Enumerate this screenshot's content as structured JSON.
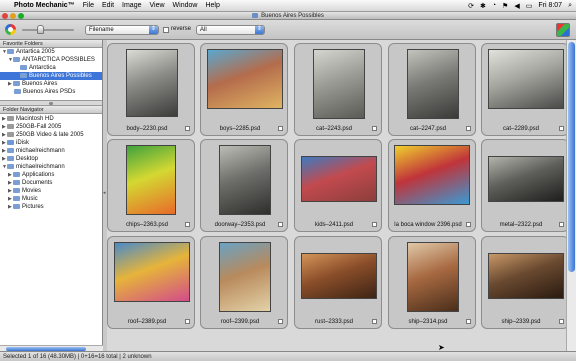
{
  "menubar": {
    "app_name": "Photo Mechanic™",
    "menus": [
      "File",
      "Edit",
      "Image",
      "View",
      "Window",
      "Help"
    ],
    "clock": "Fri 8:07"
  },
  "window": {
    "title": "Buenos Aires Possibles"
  },
  "toolbar": {
    "sort_field": "Filename",
    "reverse_label": "reverse",
    "filter_value": "All"
  },
  "favorites": {
    "header": "Favorite Folders",
    "items": [
      "Antartica 2005",
      "ANTARCTICA POSSIBLES",
      "Antarctica",
      "Buenos Aires Possibles",
      "Buenos Aires",
      "Buenos Aires PSDs"
    ]
  },
  "navigator": {
    "header": "Folder Navigator",
    "items": [
      "Macintosh HD",
      "250GB-Fall 2005",
      "250GB Video & late 2005",
      "iDisk",
      "michaelreichmann",
      "Desktop",
      "michaelreichmann",
      "Applications",
      "Documents",
      "Movies",
      "Music",
      "Pictures"
    ]
  },
  "thumbnails": [
    {
      "name": "body–2230.psd",
      "colors": [
        "#8a8a86",
        "#dcdcd6",
        "#3c3c3a"
      ]
    },
    {
      "name": "boys–2285.psd",
      "colors": [
        "#b46c4c",
        "#5aa8cf",
        "#e0b462"
      ]
    },
    {
      "name": "cat–2243.psd",
      "colors": [
        "#9c9c96",
        "#d6d6d0",
        "#5a5a56"
      ]
    },
    {
      "name": "cat–2247.psd",
      "colors": [
        "#7a7a76",
        "#c4c4be",
        "#3a3a38"
      ]
    },
    {
      "name": "cat–2289.psd",
      "colors": [
        "#a6a6a0",
        "#e2e2dc",
        "#4a4a48"
      ]
    },
    {
      "name": "chips–2363.psd",
      "colors": [
        "#d4d832",
        "#3fa23e",
        "#e86a2a"
      ]
    },
    {
      "name": "doorway–2353.psd",
      "colors": [
        "#6e6e6a",
        "#bdbdb6",
        "#2e2e2c"
      ]
    },
    {
      "name": "kids–2411.psd",
      "colors": [
        "#c24a4e",
        "#3e7ac0",
        "#8c3e3c"
      ]
    },
    {
      "name": "la boca window 2396.psd",
      "colors": [
        "#c0343a",
        "#f0d02c",
        "#3a9ad4"
      ]
    },
    {
      "name": "metal–2322.psd",
      "colors": [
        "#5e5e5a",
        "#b4b4ae",
        "#1e1e1c"
      ]
    },
    {
      "name": "roof–2389.psd",
      "colors": [
        "#e6b43a",
        "#4a8ac8",
        "#d24c8a"
      ]
    },
    {
      "name": "roof–2399.psd",
      "colors": [
        "#b88a5c",
        "#6aa2c4",
        "#e4d2a8"
      ]
    },
    {
      "name": "rust–2333.psd",
      "colors": [
        "#8a4e2a",
        "#d49458",
        "#3e2414"
      ]
    },
    {
      "name": "ship–2314.psd",
      "colors": [
        "#a86a42",
        "#e0c8a8",
        "#4a2e1a"
      ]
    },
    {
      "name": "ship–2339.psd",
      "colors": [
        "#6a4a30",
        "#c89868",
        "#2a1a10"
      ]
    }
  ],
  "status": "Selected 1 of 16 (48.30MB) | 0+16=16 total | 2 unknown"
}
